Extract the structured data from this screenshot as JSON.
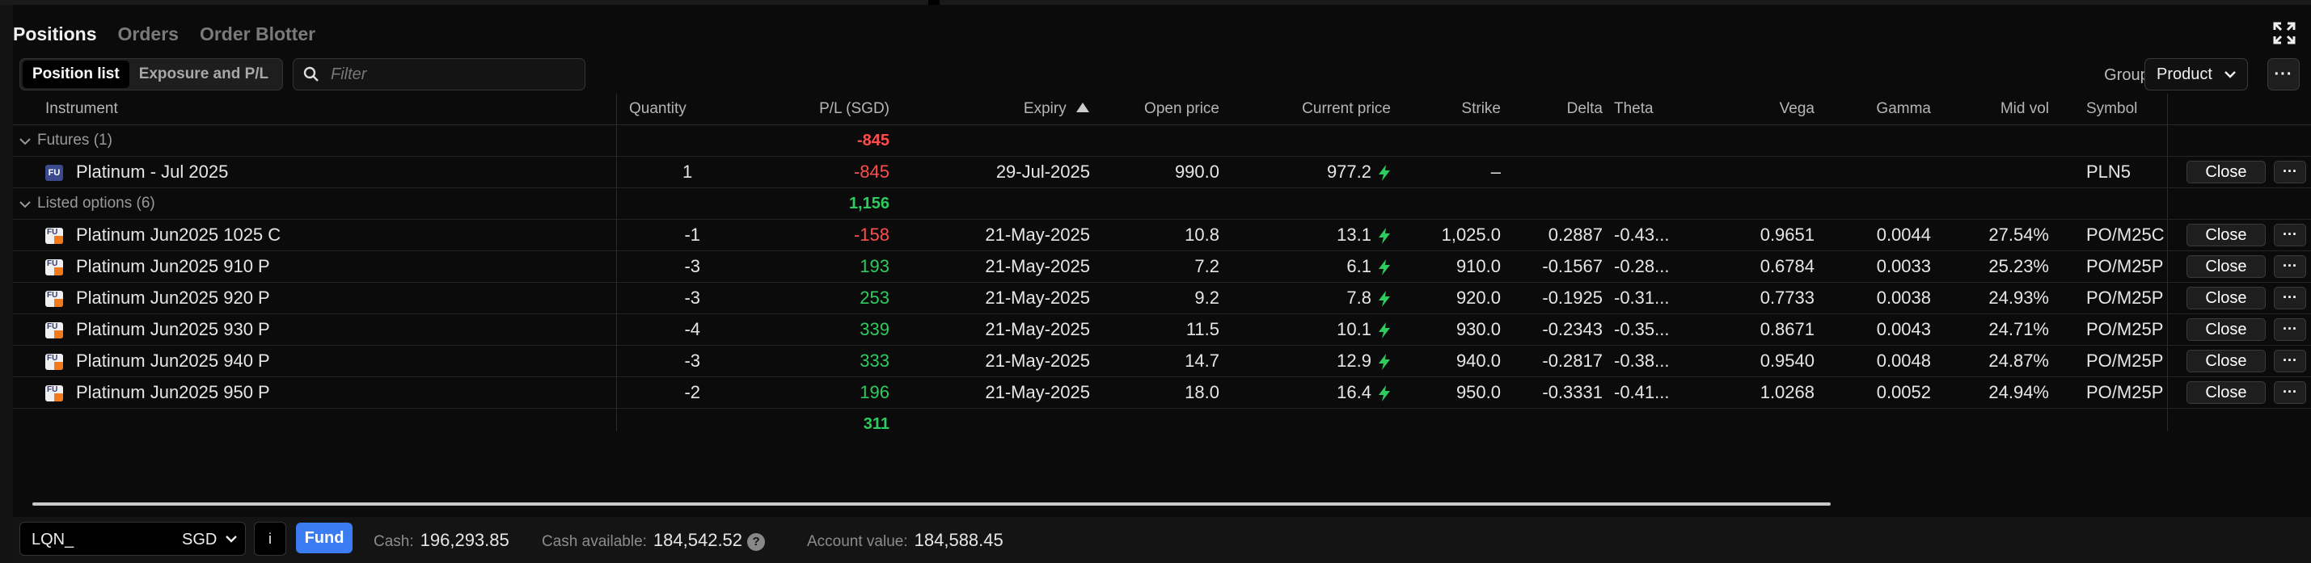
{
  "tabs": [
    {
      "label": "Positions",
      "active": true
    },
    {
      "label": "Orders",
      "active": false
    },
    {
      "label": "Order Blotter",
      "active": false
    }
  ],
  "toolbar": {
    "view_options": [
      "Position list",
      "Exposure and P/L"
    ],
    "filter_placeholder": "Filter",
    "group_by_label": "Group by:",
    "group_by_value": "Product",
    "more_label": "···"
  },
  "columns": {
    "instrument": "Instrument",
    "quantity": "Quantity",
    "pl": "P/L (SGD)",
    "expiry": "Expiry",
    "open_price": "Open price",
    "current_price": "Current price",
    "strike": "Strike",
    "delta": "Delta",
    "theta": "Theta",
    "vega": "Vega",
    "gamma": "Gamma",
    "mid_vol": "Mid vol",
    "symbol": "Symbol"
  },
  "groups": [
    {
      "label": "Futures (1)",
      "pl": "-845",
      "rows": [
        {
          "icon": "FU",
          "instrument": "Platinum - Jul 2025",
          "quantity": "1",
          "pl": "-845",
          "expiry": "29-Jul-2025",
          "open_price": "990.0",
          "current_price": "977.2",
          "strike": "–",
          "delta": "",
          "theta": "",
          "vega": "",
          "gamma": "",
          "mid_vol": "",
          "symbol": "PLN5"
        }
      ]
    },
    {
      "label": "Listed options (6)",
      "pl": "1,156",
      "rows": [
        {
          "icon": "FU",
          "instrument": "Platinum Jun2025 1025 C",
          "quantity": "-1",
          "pl": "-158",
          "expiry": "21-May-2025",
          "open_price": "10.8",
          "current_price": "13.1",
          "strike": "1,025.0",
          "delta": "0.2887",
          "theta": "-0.43...",
          "vega": "0.9651",
          "gamma": "0.0044",
          "mid_vol": "27.54%",
          "symbol": "PO/M25C"
        },
        {
          "icon": "FU",
          "instrument": "Platinum Jun2025 910 P",
          "quantity": "-3",
          "pl": "193",
          "expiry": "21-May-2025",
          "open_price": "7.2",
          "current_price": "6.1",
          "strike": "910.0",
          "delta": "-0.1567",
          "theta": "-0.28...",
          "vega": "0.6784",
          "gamma": "0.0033",
          "mid_vol": "25.23%",
          "symbol": "PO/M25P"
        },
        {
          "icon": "FU",
          "instrument": "Platinum Jun2025 920 P",
          "quantity": "-3",
          "pl": "253",
          "expiry": "21-May-2025",
          "open_price": "9.2",
          "current_price": "7.8",
          "strike": "920.0",
          "delta": "-0.1925",
          "theta": "-0.31...",
          "vega": "0.7733",
          "gamma": "0.0038",
          "mid_vol": "24.93%",
          "symbol": "PO/M25P"
        },
        {
          "icon": "FU",
          "instrument": "Platinum Jun2025 930 P",
          "quantity": "-4",
          "pl": "339",
          "expiry": "21-May-2025",
          "open_price": "11.5",
          "current_price": "10.1",
          "strike": "930.0",
          "delta": "-0.2343",
          "theta": "-0.35...",
          "vega": "0.8671",
          "gamma": "0.0043",
          "mid_vol": "24.71%",
          "symbol": "PO/M25P"
        },
        {
          "icon": "FU",
          "instrument": "Platinum Jun2025 940 P",
          "quantity": "-3",
          "pl": "333",
          "expiry": "21-May-2025",
          "open_price": "14.7",
          "current_price": "12.9",
          "strike": "940.0",
          "delta": "-0.2817",
          "theta": "-0.38...",
          "vega": "0.9540",
          "gamma": "0.0048",
          "mid_vol": "24.87%",
          "symbol": "PO/M25P"
        },
        {
          "icon": "FU",
          "instrument": "Platinum Jun2025 950 P",
          "quantity": "-2",
          "pl": "196",
          "expiry": "21-May-2025",
          "open_price": "18.0",
          "current_price": "16.4",
          "strike": "950.0",
          "delta": "-0.3331",
          "theta": "-0.41...",
          "vega": "1.0268",
          "gamma": "0.0052",
          "mid_vol": "24.94%",
          "symbol": "PO/M25P"
        }
      ]
    }
  ],
  "total_pl": "311",
  "close_label": "Close",
  "row_more_label": "···",
  "footer": {
    "account": "LQN_",
    "currency": "SGD",
    "info_label": "i",
    "fund_label": "Fund",
    "cash_label": "Cash:",
    "cash_value": "196,293.85",
    "cash_available_label": "Cash available:",
    "cash_available_value": "184,542.52",
    "help_label": "?",
    "account_value_label": "Account value:",
    "account_value_value": "184,588.45"
  },
  "colors": {
    "negative": "#ff4d4d",
    "positive": "#2ecc5e",
    "accent": "#3b7cf2",
    "bolt": "#2ecc5e"
  },
  "icons": [
    "expand-icon",
    "search-icon",
    "chevron-down-icon",
    "lightning-icon",
    "future-icon",
    "option-icon"
  ]
}
